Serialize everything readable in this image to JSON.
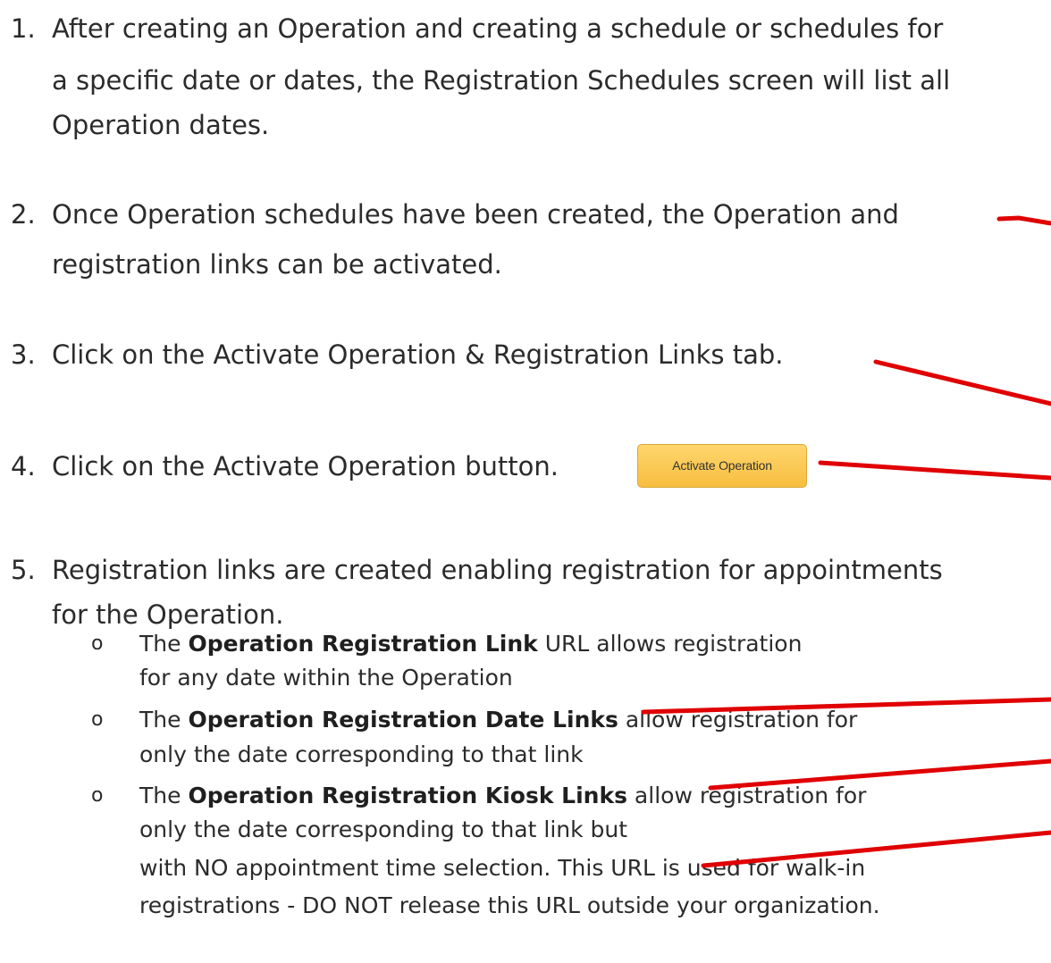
{
  "steps": [
    {
      "number": "1.",
      "lines": [
        "After creating an Operation and creating a schedule or schedules for",
        "a specific date or dates, the Registration Schedules screen will list all",
        "Operation dates."
      ]
    },
    {
      "number": "2.",
      "lines": [
        "Once Operation schedules have been created, the Operation and",
        "registration links can be activated."
      ]
    },
    {
      "number": "3.",
      "lines": [
        "Click on the Activate Operation & Registration Links tab."
      ]
    },
    {
      "number": "4.",
      "lines": [
        "Click on the Activate Operation button."
      ],
      "button_label": "Activate Operation"
    },
    {
      "number": "5.",
      "lines": [
        "Registration links are created enabling registration for appointments",
        "for the Operation."
      ]
    }
  ],
  "bullet_symbol": "o",
  "sub_items": [
    {
      "pre": "The ",
      "bold": "Operation Registration Link",
      "post": " URL allows registration",
      "lines": [
        "for any date within the Operation"
      ]
    },
    {
      "pre": "The ",
      "bold": "Operation Registration Date Links",
      "post": " allow registration for",
      "lines": [
        "only the date corresponding to that link"
      ]
    },
    {
      "pre": "The ",
      "bold": "Operation Registration Kiosk Links",
      "post": " allow registration for",
      "lines": [
        "only the date corresponding to that link but",
        "with NO appointment time selection.  This URL is used for walk-in",
        "registrations - DO NOT release this URL outside your organization."
      ]
    }
  ],
  "colors": {
    "text": "#2b2b2b",
    "arrow": "#e00000",
    "button_fill": "#f9c44f",
    "button_border": "#d9a93a"
  }
}
